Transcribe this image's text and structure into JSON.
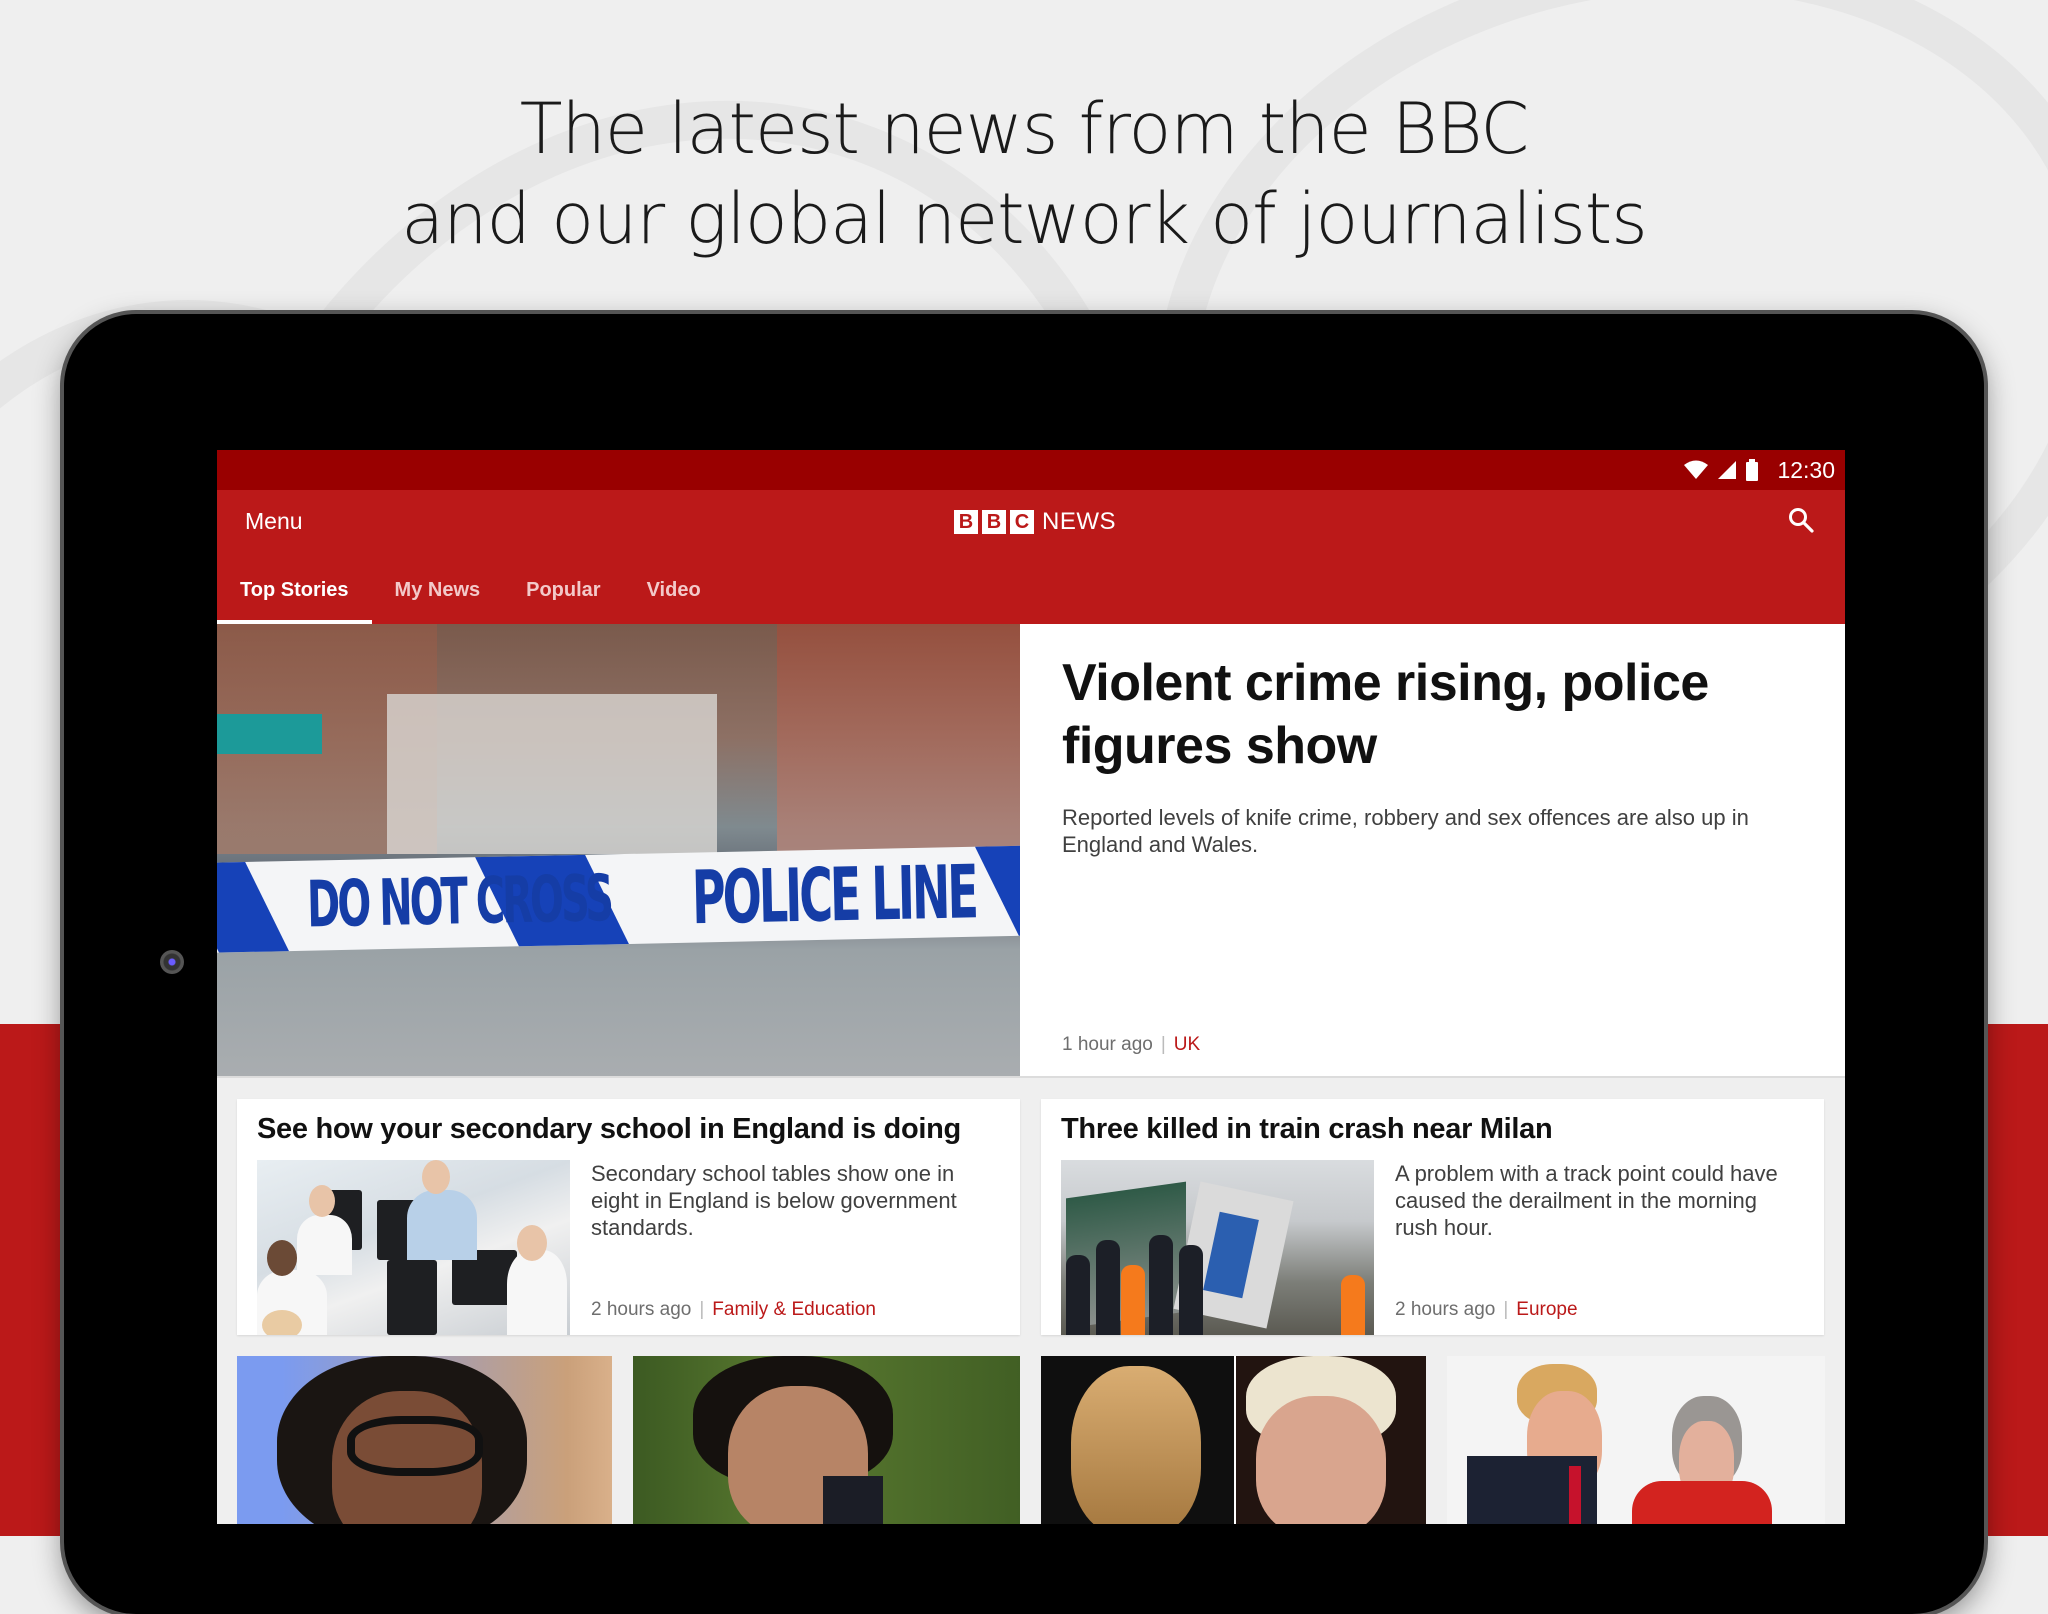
{
  "promo": {
    "line1": "The latest news from the BBC",
    "line2": "and our global network of journalists"
  },
  "status_bar": {
    "time": "12:30",
    "icons": [
      "wifi-icon",
      "cellular-signal-icon",
      "battery-icon"
    ]
  },
  "app_bar": {
    "menu_label": "Menu",
    "logo_letters": [
      "B",
      "B",
      "C"
    ],
    "logo_word": "NEWS",
    "search_icon": "search-icon"
  },
  "tabs": [
    {
      "label": "Top Stories",
      "active": true
    },
    {
      "label": "My News",
      "active": false
    },
    {
      "label": "Popular",
      "active": false
    },
    {
      "label": "Video",
      "active": false
    }
  ],
  "hero": {
    "image_text": [
      "DO NOT CROSS",
      "POLICE LINE"
    ],
    "headline": "Violent crime rising, police figures show",
    "summary": "Reported levels of knife crime, robbery and sex offences are also up in England and Wales.",
    "time": "1 hour ago",
    "section": "UK"
  },
  "stories": [
    {
      "headline": "See how your secondary school in England is doing",
      "summary": "Secondary school tables show one in eight in England is below government standards.",
      "time": "2 hours ago",
      "section": "Family & Education"
    },
    {
      "headline": "Three killed in train crash near Milan",
      "summary": "A problem with a track point could have caused the derailment in the morning rush hour.",
      "time": "2 hours ago",
      "section": "Europe"
    }
  ],
  "colors": {
    "brand_red": "#bb1919",
    "status_bar_red": "#990000",
    "section_link": "#bb1919"
  }
}
